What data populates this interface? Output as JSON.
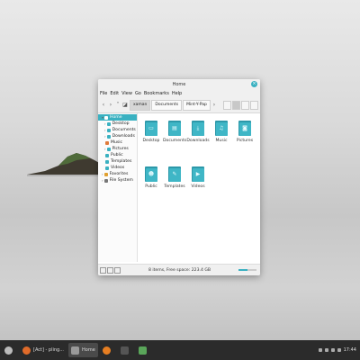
{
  "window": {
    "title": "Home",
    "menu": [
      "File",
      "Edit",
      "View",
      "Go",
      "Bookmarks",
      "Help"
    ],
    "breadcrumbs": [
      "xaman",
      "Documents",
      "Mint-Y-Pap"
    ],
    "status": "8 items, Free space: 223.4 GB",
    "zoom_level": 0.5
  },
  "sidebar": {
    "items": [
      {
        "label": "Home",
        "icon": "home-icon",
        "selected": true,
        "arrow": "▾"
      },
      {
        "label": "Desktop",
        "icon": "desktop-icon",
        "arrow": "›"
      },
      {
        "label": "Documents",
        "icon": "documents-icon",
        "arrow": "›"
      },
      {
        "label": "Downloads",
        "icon": "downloads-icon",
        "arrow": "›"
      },
      {
        "label": "Music",
        "icon": "music-icon",
        "arrow": ""
      },
      {
        "label": "Pictures",
        "icon": "pictures-icon",
        "arrow": "›"
      },
      {
        "label": "Public",
        "icon": "public-icon",
        "arrow": ""
      },
      {
        "label": "Templates",
        "icon": "templates-icon",
        "arrow": ""
      },
      {
        "label": "Videos",
        "icon": "videos-icon",
        "arrow": ""
      },
      {
        "label": "Favorites",
        "icon": "star-icon",
        "arrow": "›"
      },
      {
        "label": "File System",
        "icon": "drive-icon",
        "arrow": "›"
      }
    ]
  },
  "folders": [
    {
      "label": "Desktop",
      "icon": "desktop-folder-icon",
      "symbol": "▭"
    },
    {
      "label": "Documents",
      "icon": "documents-folder-icon",
      "symbol": "▤"
    },
    {
      "label": "Downloads",
      "icon": "downloads-folder-icon",
      "symbol": "⤓"
    },
    {
      "label": "Music",
      "icon": "music-folder-icon",
      "symbol": "♫"
    },
    {
      "label": "Pictures",
      "icon": "pictures-folder-icon",
      "symbol": "◙"
    },
    {
      "label": "Public",
      "icon": "public-folder-icon",
      "symbol": "☻"
    },
    {
      "label": "Templates",
      "icon": "templates-folder-icon",
      "symbol": "✎"
    },
    {
      "label": "Videos",
      "icon": "videos-folder-icon",
      "symbol": "▶"
    }
  ],
  "taskbar": {
    "apps": [
      {
        "label": "[Act] - pling...",
        "active": false,
        "icon": "browser-icon"
      },
      {
        "label": "Home",
        "active": true,
        "icon": "file-manager-icon"
      }
    ],
    "clock": "17:44"
  },
  "colors": {
    "accent": "#3ab1c1",
    "folder": "#3fb6c6",
    "taskbar": "#2b2b2b"
  }
}
